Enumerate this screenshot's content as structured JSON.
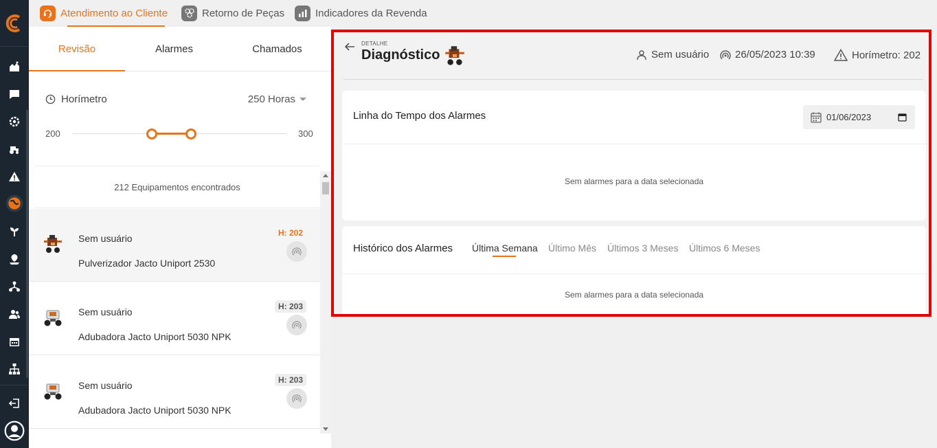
{
  "nav": {
    "items": [
      {
        "name": "dashboard-icon"
      },
      {
        "name": "chat-icon"
      },
      {
        "name": "settings-gear-icon"
      },
      {
        "name": "tractor-icon"
      },
      {
        "name": "warning-icon"
      },
      {
        "name": "globe-icon",
        "active": true
      },
      {
        "name": "plant-icon"
      },
      {
        "name": "map-pin-icon"
      },
      {
        "name": "hierarchy-icon"
      },
      {
        "name": "users-icon"
      },
      {
        "name": "calendar-icon"
      },
      {
        "name": "sitemap-icon"
      },
      {
        "name": "logout-icon"
      },
      {
        "name": "profile-icon"
      }
    ]
  },
  "top_tabs": [
    {
      "label": "Atendimento ao Cliente",
      "icon": "support-icon",
      "active": true
    },
    {
      "label": "Retorno de Peças",
      "icon": "gears-icon",
      "active": false
    },
    {
      "label": "Indicadores da Revenda",
      "icon": "bar-chart-icon",
      "active": false
    }
  ],
  "sub_tabs": [
    {
      "label": "Revisão",
      "active": true
    },
    {
      "label": "Alarmes",
      "active": false
    },
    {
      "label": "Chamados",
      "active": false
    }
  ],
  "filter": {
    "horimetro_label": "Horímetro",
    "horas_value": "250 Horas",
    "slider_min": "200",
    "slider_max": "300",
    "range_low_fraction": 0.37,
    "range_high_fraction": 0.55
  },
  "equipment_count": "212 Equipamentos encontrados",
  "equipment": [
    {
      "user": "Sem usuário",
      "name": "Pulverizador Jacto Uniport 2530",
      "hours": "H: 202",
      "selected": true
    },
    {
      "user": "Sem usuário",
      "name": "Adubadora Jacto Uniport 5030 NPK",
      "hours": "H: 203",
      "selected": false
    },
    {
      "user": "Sem usuário",
      "name": "Adubadora Jacto Uniport 5030 NPK",
      "hours": "H: 203",
      "selected": false
    }
  ],
  "detail": {
    "overline": "DETALHE",
    "title": "Diagnóstico",
    "user": "Sem usuário",
    "datetime": "26/05/2023 10:39",
    "horimetro": "Horímetro: 202",
    "timeline_title": "Linha do Tempo dos Alarmes",
    "date_value": "01/06/2023",
    "timeline_empty": "Sem alarmes para a data selecionada",
    "history_title": "Histórico dos Alarmes",
    "periods": [
      {
        "label": "Última Semana",
        "active": true
      },
      {
        "label": "Último Mês",
        "active": false
      },
      {
        "label": "Últimos 3 Meses",
        "active": false
      },
      {
        "label": "Últimos 6 Meses",
        "active": false
      }
    ],
    "history_empty": "Sem alarmes para a data selecionada"
  },
  "colors": {
    "accent": "#e8731a",
    "rail": "#1c2630",
    "highlight": "#e00000"
  }
}
